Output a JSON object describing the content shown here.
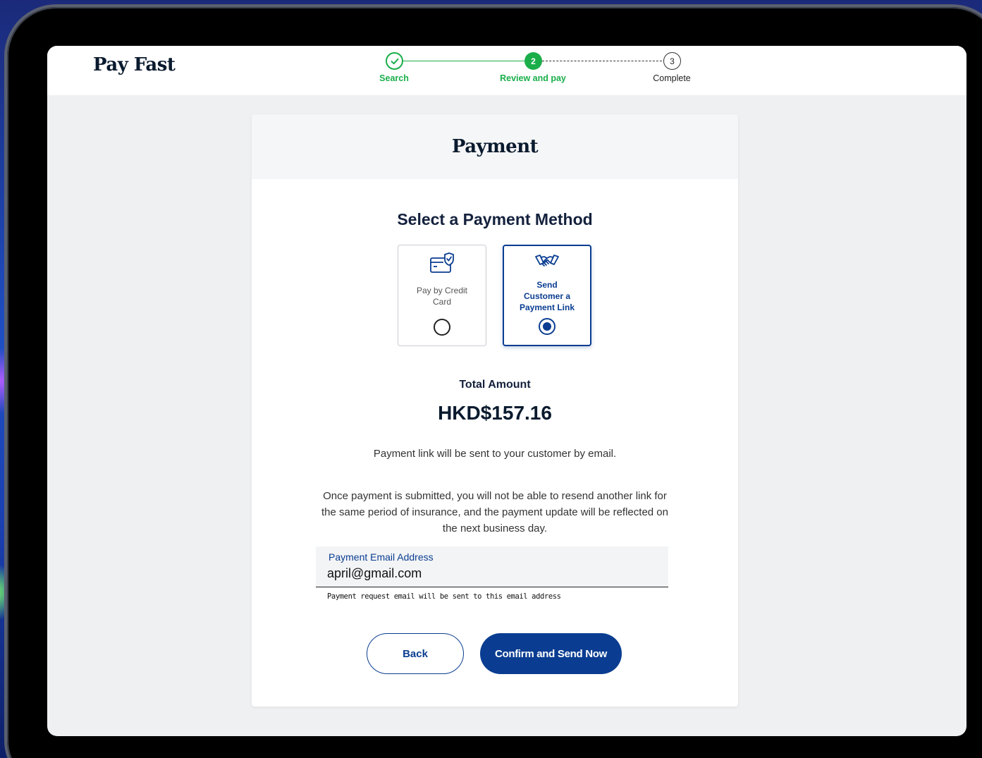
{
  "app": {
    "brand": "Pay Fast"
  },
  "stepper": {
    "steps": [
      {
        "label": "Search",
        "status": "done",
        "marker": "✓"
      },
      {
        "label": "Review and pay",
        "status": "current",
        "marker": "2"
      },
      {
        "label": "Complete",
        "status": "todo",
        "marker": "3"
      }
    ]
  },
  "payment": {
    "title": "Payment",
    "method_title": "Select a Payment Method",
    "options": [
      {
        "label": "Pay by Credit Card",
        "icon": "credit-card-shield-icon",
        "selected": false
      },
      {
        "label": "Send Customer a Payment Link",
        "icon": "handshake-icon",
        "selected": true
      }
    ],
    "total_label": "Total Amount",
    "total_amount": "HKD$157.16",
    "note_email": "Payment link will be sent to your customer by email.",
    "note_policy": "Once payment is submitted, you will not be able to resend another link for the same period of insurance, and the payment update will be reflected on the next business day.",
    "email_field": {
      "label": "Payment Email Address",
      "value": "april@gmail.com",
      "helper": "Payment request email will be sent to this email address"
    },
    "buttons": {
      "back": "Back",
      "confirm": "Confirm and Send Now"
    }
  },
  "colors": {
    "primary": "#0a3d91",
    "success": "#1aae4a",
    "page_bg": "#eff0f2"
  }
}
